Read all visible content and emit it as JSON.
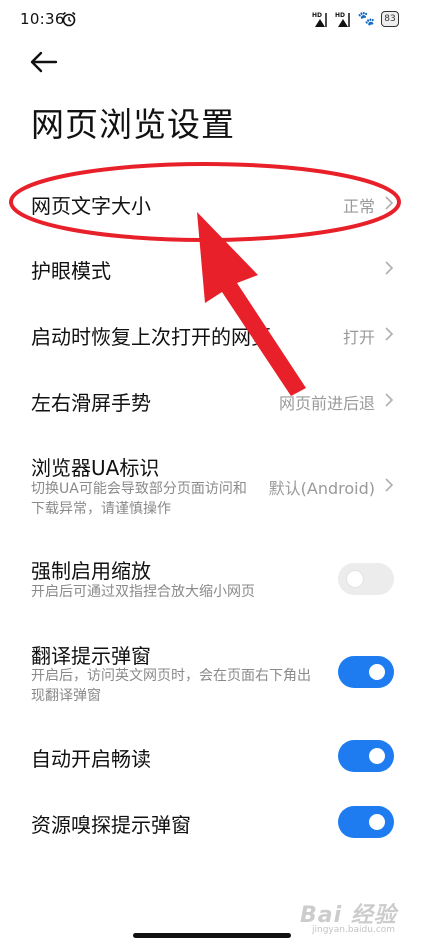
{
  "status_bar": {
    "time": "10:36",
    "battery": "83"
  },
  "page": {
    "title": "网页浏览设置"
  },
  "settings": [
    {
      "label": "网页文字大小",
      "value": "正常",
      "kind": "chevron"
    },
    {
      "label": "护眼模式",
      "value": "",
      "kind": "chevron"
    },
    {
      "label": "启动时恢复上次打开的网页",
      "value": "打开",
      "kind": "chevron"
    },
    {
      "label": "左右滑屏手势",
      "value": "网页前进后退",
      "kind": "chevron"
    },
    {
      "label": "浏览器UA标识",
      "description": "切换UA可能会导致部分页面访问和下载异常，请谨慎操作",
      "value": "默认(Android)",
      "kind": "chevron"
    },
    {
      "label": "强制启用缩放",
      "description": "开启后可通过双指捏合放大缩小网页",
      "kind": "toggle",
      "checked": false
    },
    {
      "label": "翻译提示弹窗",
      "description": "开启后，访问英文网页时，会在页面右下角出现翻译弹窗",
      "kind": "toggle",
      "checked": true
    },
    {
      "label": "自动开启畅读",
      "kind": "toggle",
      "checked": true
    },
    {
      "label": "资源嗅探提示弹窗",
      "kind": "toggle",
      "checked": true
    }
  ],
  "watermark": {
    "brand": "Bai 经验",
    "url": "jingyan.baidu.com"
  },
  "colors": {
    "toggle_on": "#1e7cf0",
    "toggle_off": "#ececec",
    "annotation_red": "#e8202a"
  }
}
